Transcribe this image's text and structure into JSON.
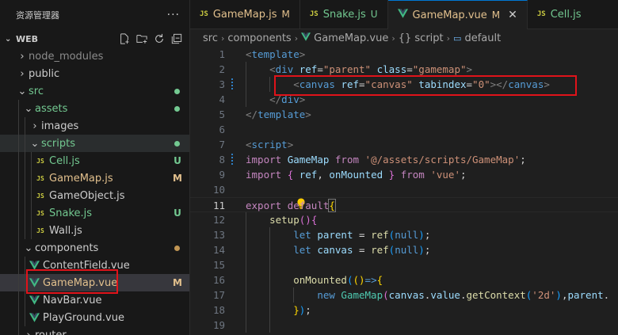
{
  "sidebar": {
    "title": "资源管理器",
    "more": "···",
    "root": "WEB",
    "items": [
      {
        "label": "node_modules",
        "status": "",
        "dot": ""
      },
      {
        "label": "public",
        "status": "",
        "dot": ""
      },
      {
        "label": "src",
        "status": "",
        "dot": "#73c991"
      },
      {
        "label": "assets",
        "status": "",
        "dot": "#73c991"
      },
      {
        "label": "images",
        "status": "",
        "dot": ""
      },
      {
        "label": "scripts",
        "status": "",
        "dot": "#73c991"
      },
      {
        "label": "Cell.js",
        "status": "U",
        "dot": ""
      },
      {
        "label": "GameMap.js",
        "status": "M",
        "dot": ""
      },
      {
        "label": "GameObject.js",
        "status": "",
        "dot": ""
      },
      {
        "label": "Snake.js",
        "status": "U",
        "dot": ""
      },
      {
        "label": "Wall.js",
        "status": "",
        "dot": ""
      },
      {
        "label": "components",
        "status": "",
        "dot": "#c09553"
      },
      {
        "label": "ContentField.vue",
        "status": "",
        "dot": ""
      },
      {
        "label": "GameMap.vue",
        "status": "M",
        "dot": ""
      },
      {
        "label": "NavBar.vue",
        "status": "",
        "dot": ""
      },
      {
        "label": "PlayGround.vue",
        "status": "",
        "dot": ""
      },
      {
        "label": "router",
        "status": "",
        "dot": ""
      }
    ]
  },
  "tabs": [
    {
      "label": "GameMap.js",
      "status": "M"
    },
    {
      "label": "Snake.js",
      "status": "U"
    },
    {
      "label": "GameMap.vue",
      "status": "M"
    },
    {
      "label": "Cell.js",
      "status": ""
    }
  ],
  "breadcrumb": [
    "src",
    "components",
    "GameMap.vue",
    "{} script",
    "default"
  ],
  "code": {
    "line_numbers": [
      "1",
      "2",
      "3",
      "4",
      "5",
      "6",
      "7",
      "8",
      "9",
      "10",
      "11",
      "12",
      "13",
      "14",
      "15",
      "16",
      "17",
      "18",
      "19"
    ],
    "current_line": "11"
  },
  "colors": {
    "accent": "#0078d4",
    "modified": "#e2c08d",
    "untracked": "#73c991",
    "highlight_box": "#e0131a"
  },
  "icons": {
    "js": "js-file-icon",
    "vue": "vue-file-icon",
    "bulb": "lightbulb-icon"
  }
}
